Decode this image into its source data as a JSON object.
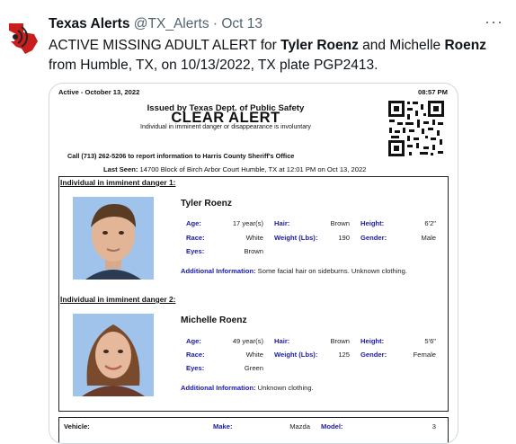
{
  "tweet": {
    "author_name": "Texas Alerts",
    "handle": "@TX_Alerts",
    "separator": "·",
    "date": "Oct 13",
    "more_icon": "more-horizontal-icon",
    "text_1": "ACTIVE MISSING ADULT ALERT for ",
    "text_name_1": "Tyler Roenz",
    "text_2": " and Michelle ",
    "text_name_2": "Roenz",
    "text_3": " from Humble, TX, on 10/13/2022, TX plate PGP2413."
  },
  "doc": {
    "status": "Active - October 13, 2022",
    "time": "08:57 PM",
    "issued_by": "Issued by Texas Dept. of Public Safety",
    "title": "CLEAR ALERT",
    "subtitle": "Individual in imminent danger or disappearance is involuntary",
    "call_line": "Call (713) 262-5206 to report information to Harris County Sheriff's Office",
    "last_seen_label": "Last Seen:",
    "last_seen_value": "14700 Block of Birch Arbor Court Humble, TX at 12:01 PM on Oct 13, 2022",
    "persons": [
      {
        "section_title": "Individual in imminent danger 1:",
        "name": "Tyler Roenz",
        "age": "17 year(s)",
        "hair": "Brown",
        "height": "6'2\"",
        "race": "White",
        "weight": "190",
        "gender": "Male",
        "eyes": "Brown",
        "addl_info": "Some facial hair on sideburns. Unknown clothing."
      },
      {
        "section_title": "Individual in imminent danger 2:",
        "name": "Michelle Roenz",
        "age": "49 year(s)",
        "hair": "Brown",
        "height": "5'6\"",
        "race": "White",
        "weight": "125",
        "gender": "Female",
        "eyes": "Green",
        "addl_info": "Unknown clothing."
      }
    ],
    "labels": {
      "age": "Age:",
      "hair": "Hair:",
      "height": "Height:",
      "race": "Race:",
      "weight": "Weight (Lbs):",
      "gender": "Gender:",
      "eyes": "Eyes:",
      "addl": "Additional Information:"
    },
    "vehicle": {
      "label": "Vehicle:",
      "make_label": "Make:",
      "make": "Mazda",
      "model_label": "Model:",
      "model": "3"
    }
  },
  "colors": {
    "label_blue": "#1a1aa8",
    "text": "#0f1419",
    "muted": "#536471",
    "border": "#cfd9de"
  }
}
